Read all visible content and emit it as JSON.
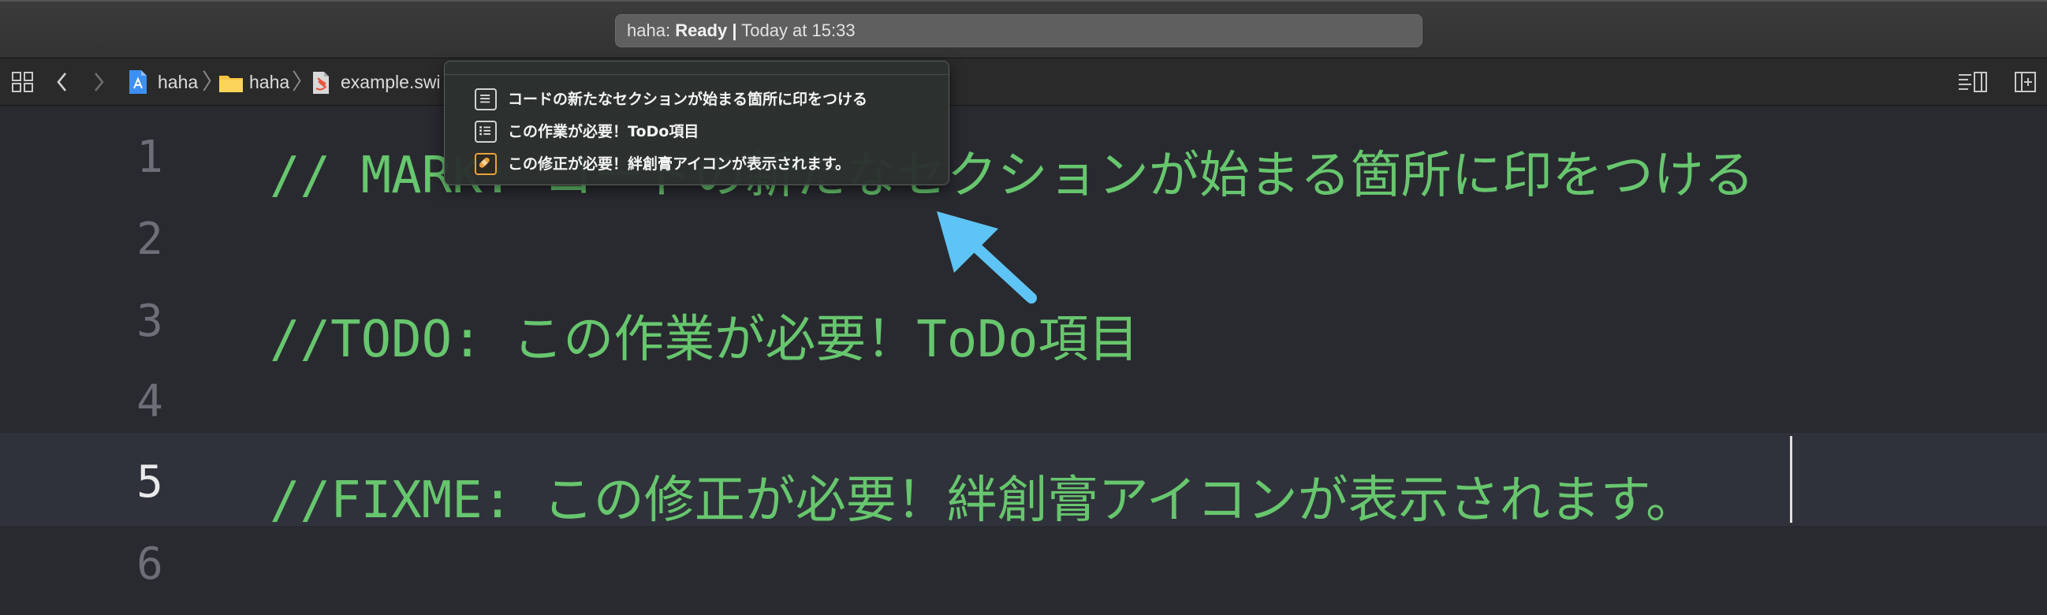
{
  "titlebar": {
    "project": "haha:",
    "status": "Ready",
    "separator": "|",
    "time": "Today at 15:33"
  },
  "jumpbar": {
    "crumbs": [
      "haha",
      "haha",
      "example.swi"
    ]
  },
  "editor": {
    "lines": [
      {
        "num": "1",
        "text": "// MARK: コードの新たなセクションが始まる箇所に印をつける"
      },
      {
        "num": "2",
        "text": ""
      },
      {
        "num": "3",
        "text": "//TODO: この作業が必要！ToDo項目"
      },
      {
        "num": "4",
        "text": ""
      },
      {
        "num": "5",
        "text": "//FIXME: この修正が必要！絆創膏アイコンが表示されます。"
      },
      {
        "num": "6",
        "text": ""
      }
    ],
    "current_line": "5"
  },
  "popover": {
    "items": [
      {
        "label": "コードの新たなセクションが始まる箇所に印をつける",
        "icon": "mark-section-icon"
      },
      {
        "label": "この作業が必要！ToDo項目",
        "icon": "todo-list-icon"
      },
      {
        "label": "この修正が必要！絆創膏アイコンが表示されます。",
        "icon": "bandage-icon"
      }
    ]
  },
  "colors": {
    "editor_bg": "#292a30",
    "comment": "#67c66e",
    "line_number": "#6c6f78",
    "arrow": "#5ec4f5",
    "fixme_icon": "#e9a13b"
  }
}
